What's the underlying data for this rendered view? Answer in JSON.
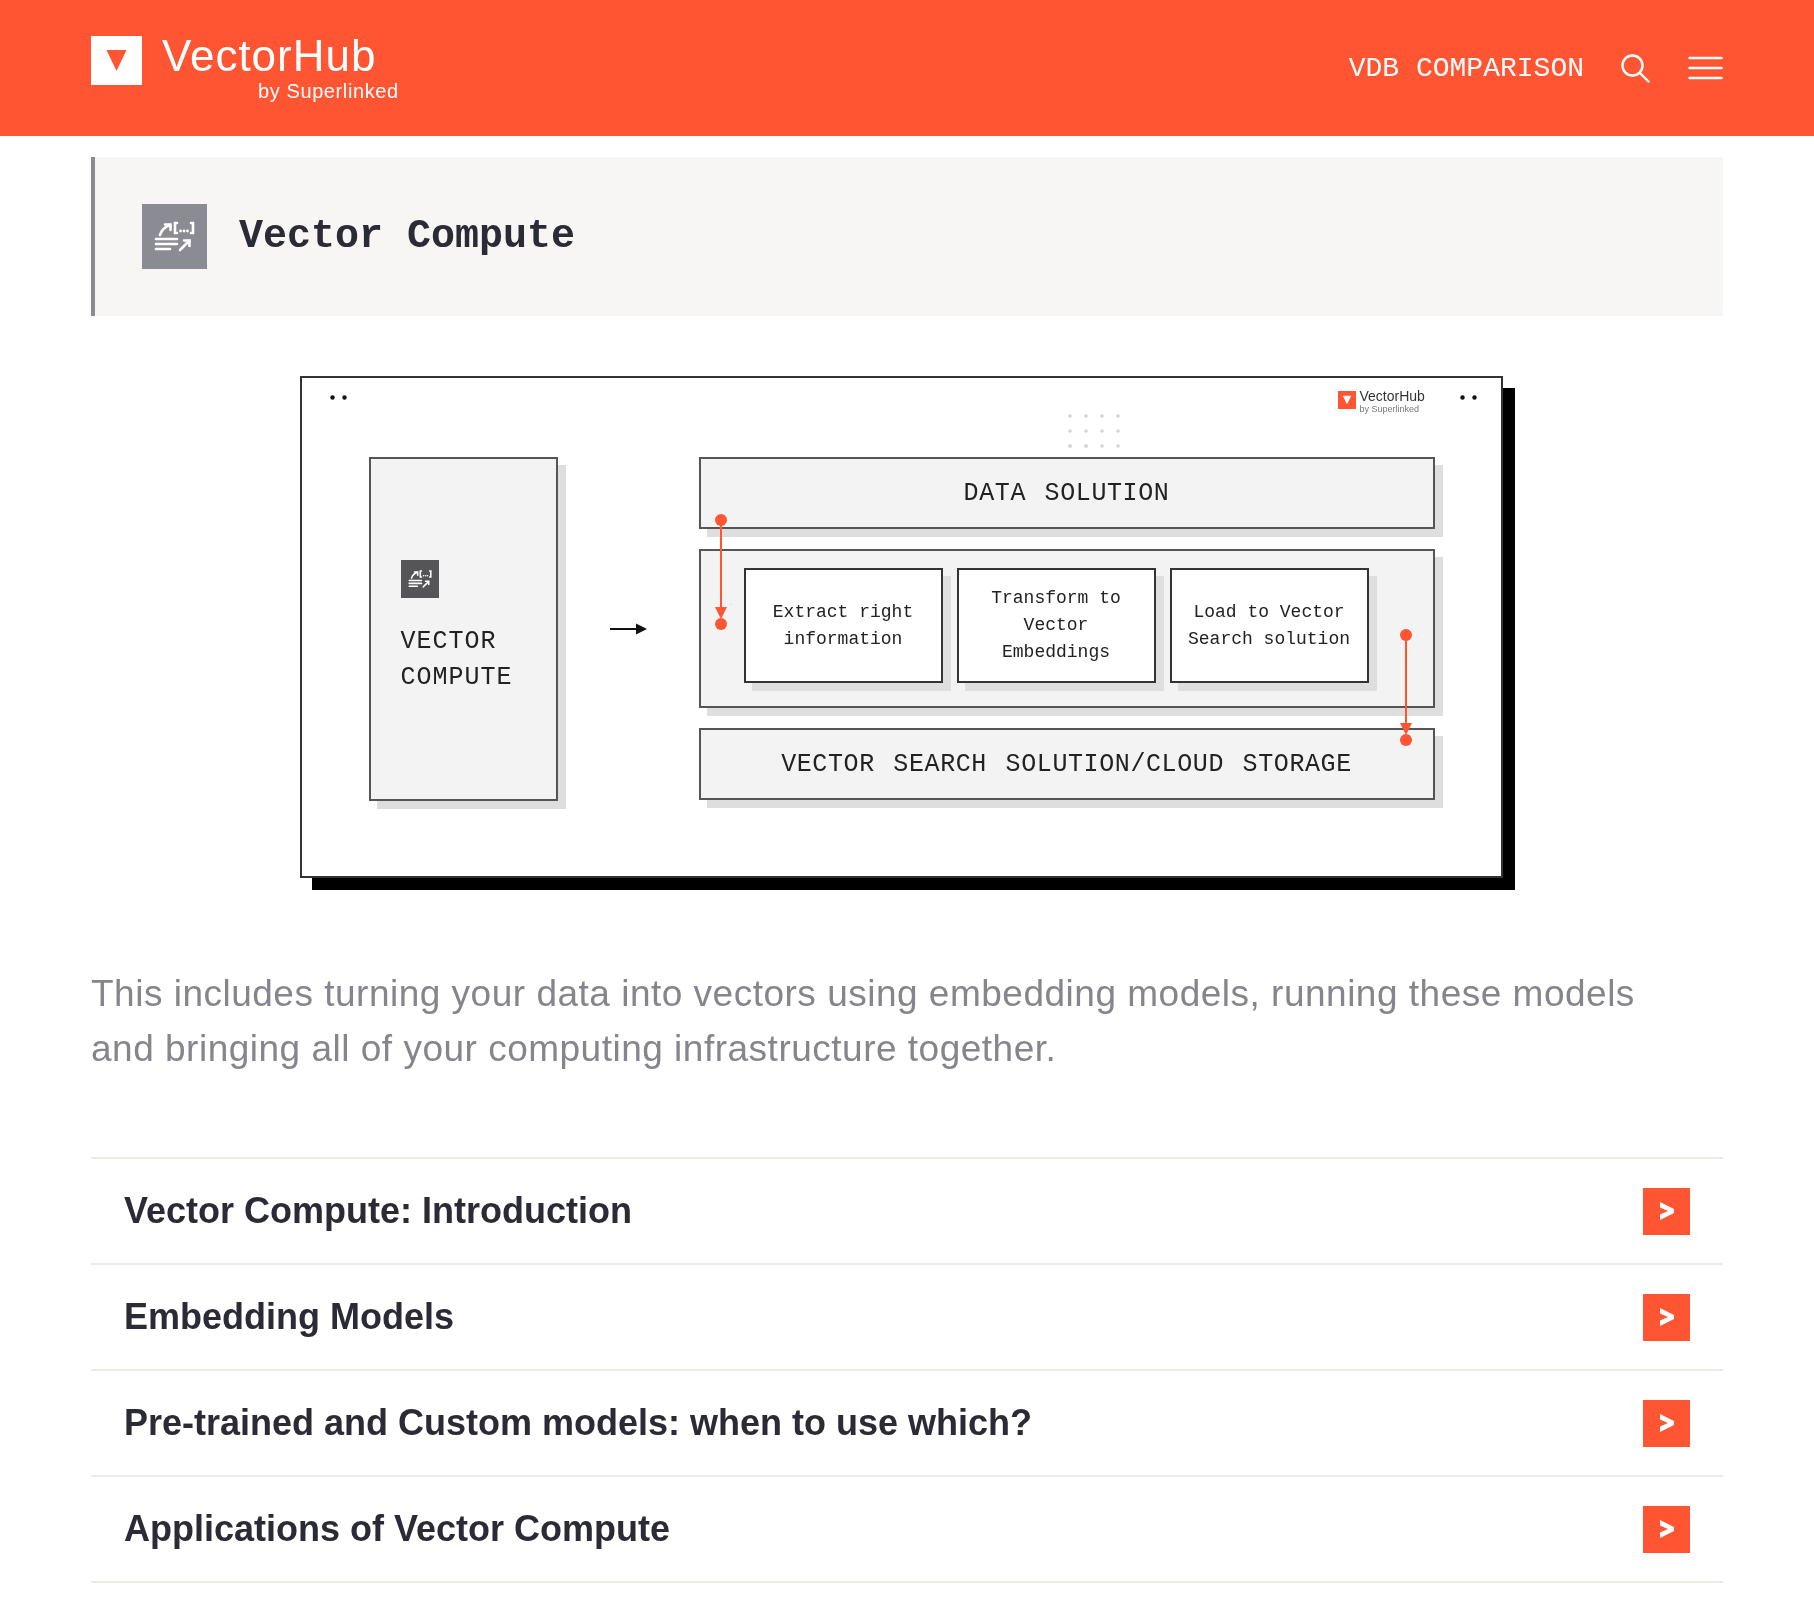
{
  "header": {
    "logo": {
      "name": "VectorHub",
      "tagline": "by Superlinked"
    },
    "nav": [
      {
        "label": "VDB COMPARISON"
      }
    ]
  },
  "section": {
    "title": "Vector Compute"
  },
  "diagram": {
    "logo": {
      "name": "VectorHub",
      "tagline": "by Superlinked"
    },
    "source": "VECTOR COMPUTE",
    "layers": [
      {
        "kind": "bar",
        "label": "DATA SOLUTION"
      },
      {
        "kind": "steps",
        "steps": [
          "Extract right information",
          "Transform to Vector Embeddings",
          "Load to Vector Search solution"
        ]
      },
      {
        "kind": "bar",
        "label": "VECTOR SEARCH SOLUTION/CLOUD STORAGE"
      }
    ]
  },
  "description": "This includes turning your data into vectors using embedding models, running these models and bringing all of your computing infrastructure together.",
  "topics": [
    {
      "title": "Vector Compute: Introduction"
    },
    {
      "title": "Embedding Models"
    },
    {
      "title": "Pre-trained and Custom models: when to use which?"
    },
    {
      "title": "Applications of Vector Compute"
    }
  ]
}
